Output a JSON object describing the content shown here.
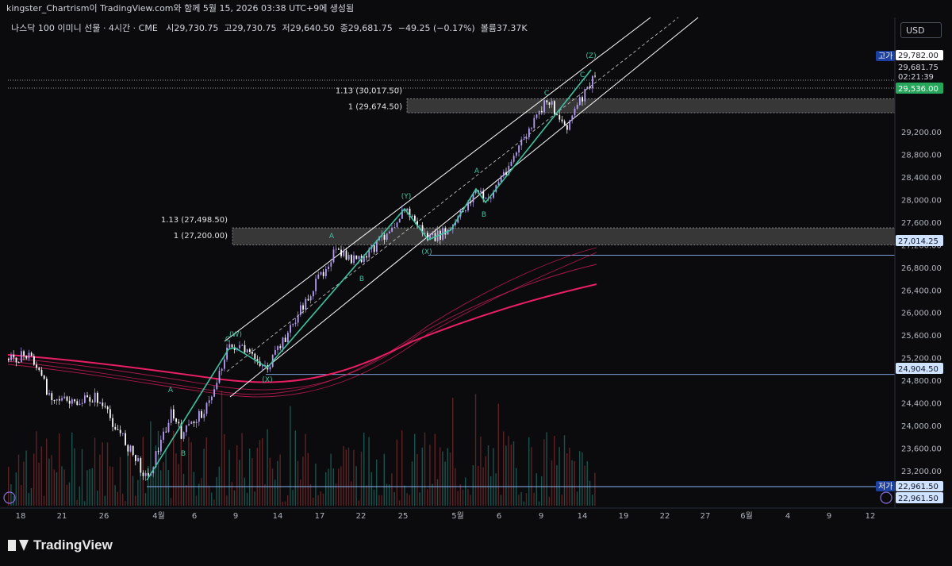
{
  "header": {
    "attribution": "kingster_Chartrism이 TradingView.com와 함께 5월 15, 2026 03:38 UTC+9에 생성됨",
    "symbol_line": "나스닥 100 이미니 선물 · 4시간 · CME",
    "open": "시29,730.75",
    "high": "고29,730.75",
    "low": "저29,640.50",
    "close": "종29,681.75",
    "change": "−49.25 (−0.17%)",
    "volume": "볼륨37.37K",
    "currency": "USD"
  },
  "footer": {
    "brand": "TradingView"
  },
  "colors": {
    "background": "#0b0b0d",
    "up_candle": "#b49cf0",
    "down_candle": "#ffffff",
    "ema": "#e91e63",
    "channel": "#ffffff",
    "wave_line": "#3cc4a0",
    "level_line": "#8ab4f8",
    "zone": "#8a8a8a",
    "price_green": "#26a65b"
  },
  "chart_data": {
    "type": "candlestick",
    "title": "나스닥 100 이미니 선물 · 4시간 · CME",
    "y_axis": {
      "ticks": [
        "29,200.00",
        "28,800.00",
        "28,400.00",
        "28,000.00",
        "27,600.00",
        "27,200.00",
        "26,800.00",
        "26,400.00",
        "26,000.00",
        "25,600.00",
        "25,200.00",
        "24,800.00",
        "24,400.00",
        "24,000.00",
        "23,600.00",
        "23,200.00"
      ],
      "ylim": [
        22800,
        29950
      ]
    },
    "x_axis": {
      "ticks": [
        "18",
        "21",
        "26",
        "4월",
        "6",
        "9",
        "14",
        "17",
        "22",
        "25",
        "5월",
        "6",
        "9",
        "14",
        "19",
        "22",
        "27",
        "6월",
        "4",
        "9",
        "12"
      ]
    },
    "price_labels": {
      "high_tag": "고가",
      "high": "29,782.00",
      "last": "29,681.75",
      "countdown": "02:21:39",
      "green": "29,536.00",
      "level_1": "27,014.25",
      "level_2": "24,904.50",
      "low_tag": "저가",
      "low": "22,961.50",
      "low_2": "22,961.50"
    },
    "fib_zones": [
      {
        "top_label": "1.13 (30,017.50)",
        "bottom_label": "1 (29,674.50)",
        "top": 29782,
        "bottom": 29536
      },
      {
        "top_label": "1.13 (27,498.50)",
        "bottom_label": "1 (27,200.00)",
        "top": 27498.5,
        "bottom": 27200
      }
    ],
    "wave_labels": [
      "A",
      "B",
      "C",
      "(W)",
      "(X)",
      "A",
      "B",
      "(Y)",
      "(X)",
      "A",
      "B",
      "C",
      "(Z)",
      "C"
    ],
    "key_points": [
      {
        "date": "3/17",
        "price": 25150
      },
      {
        "date": "3/31",
        "price": 22961.5
      },
      {
        "date": "4/8",
        "price": 25200
      },
      {
        "date": "4/13",
        "price": 24904.5
      },
      {
        "date": "4/17",
        "price": 26900
      },
      {
        "date": "4/25",
        "price": 27550
      },
      {
        "date": "4/29",
        "price": 27014.25
      },
      {
        "date": "5/14",
        "price": 29782
      }
    ]
  }
}
